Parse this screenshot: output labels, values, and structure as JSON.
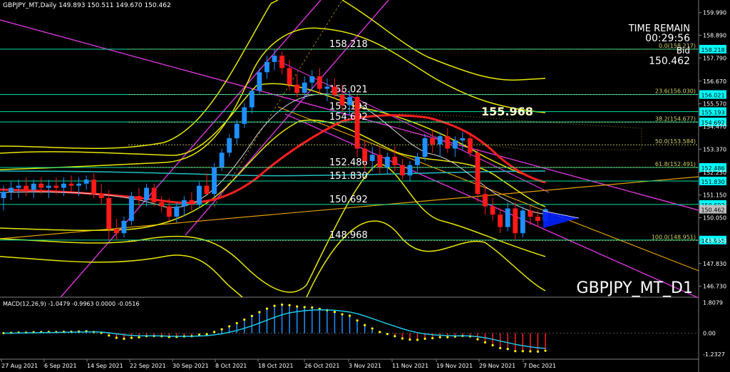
{
  "header": {
    "symbol_line": "GBPJPY_MT,Daily  149.893 150.511 149.670 150.462",
    "time_remain_label": "TIME REMAIN",
    "time_remain_value": "00:29:56",
    "bid_label": "Bid",
    "bid_value": "150.462",
    "big_price": "155.968",
    "watermark": "GBPJPY_MT_D1"
  },
  "colors": {
    "background": "#000000",
    "bull_candle": "#1e90ff",
    "bear_candle": "#ff1a1a",
    "level_line": "#00e0a0",
    "channel_line": "#cc33cc",
    "bollinger": "#ffff33",
    "ma_red": "#ff2020",
    "ma_cyan": "#20c0c0",
    "trend_orange": "#e0a000",
    "price_tag": "#00ffff",
    "macd_signal": "#ffff00",
    "macd_line": "#20c8e8"
  },
  "chart_data": {
    "type": "candlestick",
    "ylim": [
      146.2,
      160.6
    ],
    "price_axis_ticks": [
      "159.990",
      "158.890",
      "157.790",
      "156.670",
      "155.570",
      "154.470",
      "153.370",
      "152.250",
      "151.150",
      "150.050",
      "148.950",
      "147.830",
      "146.730"
    ],
    "date_labels": [
      "27 Aug 2021",
      "6 Sep 2021",
      "14 Sep 2021",
      "22 Sep 2021",
      "30 Sep 2021",
      "8 Oct 2021",
      "18 Oct 2021",
      "26 Oct 2021",
      "3 Nov 2021",
      "11 Nov 2021",
      "19 Nov 2021",
      "29 Nov 2021",
      "7 Dec 2021"
    ],
    "candles": [
      {
        "o": 151.0,
        "h": 151.6,
        "l": 150.4,
        "c": 151.3
      },
      {
        "o": 151.3,
        "h": 151.8,
        "l": 150.9,
        "c": 151.5
      },
      {
        "o": 151.5,
        "h": 151.9,
        "l": 151.0,
        "c": 151.6
      },
      {
        "o": 151.6,
        "h": 152.0,
        "l": 151.1,
        "c": 151.4
      },
      {
        "o": 151.4,
        "h": 151.9,
        "l": 151.0,
        "c": 151.7
      },
      {
        "o": 151.7,
        "h": 152.0,
        "l": 151.2,
        "c": 151.5
      },
      {
        "o": 151.5,
        "h": 151.9,
        "l": 151.0,
        "c": 151.6
      },
      {
        "o": 151.6,
        "h": 152.0,
        "l": 151.2,
        "c": 151.5
      },
      {
        "o": 151.5,
        "h": 152.0,
        "l": 151.1,
        "c": 151.7
      },
      {
        "o": 151.7,
        "h": 152.1,
        "l": 151.3,
        "c": 151.6
      },
      {
        "o": 151.6,
        "h": 152.0,
        "l": 151.1,
        "c": 151.7
      },
      {
        "o": 151.7,
        "h": 152.1,
        "l": 151.4,
        "c": 151.9
      },
      {
        "o": 151.9,
        "h": 152.2,
        "l": 151.0,
        "c": 151.2
      },
      {
        "o": 151.2,
        "h": 151.7,
        "l": 150.7,
        "c": 151.0
      },
      {
        "o": 151.0,
        "h": 151.4,
        "l": 149.0,
        "c": 149.5
      },
      {
        "o": 149.5,
        "h": 150.0,
        "l": 149.0,
        "c": 149.3
      },
      {
        "o": 149.3,
        "h": 150.1,
        "l": 149.1,
        "c": 149.9
      },
      {
        "o": 149.9,
        "h": 151.3,
        "l": 149.7,
        "c": 151.1
      },
      {
        "o": 151.1,
        "h": 151.5,
        "l": 150.6,
        "c": 150.9
      },
      {
        "o": 150.9,
        "h": 151.7,
        "l": 150.6,
        "c": 151.5
      },
      {
        "o": 151.5,
        "h": 151.7,
        "l": 150.6,
        "c": 150.8
      },
      {
        "o": 150.8,
        "h": 151.1,
        "l": 150.3,
        "c": 150.6
      },
      {
        "o": 150.6,
        "h": 151.0,
        "l": 149.9,
        "c": 150.1
      },
      {
        "o": 150.1,
        "h": 150.8,
        "l": 149.8,
        "c": 150.6
      },
      {
        "o": 150.6,
        "h": 151.1,
        "l": 150.1,
        "c": 150.9
      },
      {
        "o": 150.9,
        "h": 151.3,
        "l": 150.4,
        "c": 150.7
      },
      {
        "o": 150.7,
        "h": 151.8,
        "l": 150.5,
        "c": 151.6
      },
      {
        "o": 151.6,
        "h": 152.2,
        "l": 151.3,
        "c": 151.2
      },
      {
        "o": 151.2,
        "h": 152.7,
        "l": 151.0,
        "c": 152.5
      },
      {
        "o": 152.5,
        "h": 153.4,
        "l": 152.3,
        "c": 153.2
      },
      {
        "o": 153.2,
        "h": 154.1,
        "l": 153.0,
        "c": 153.9
      },
      {
        "o": 153.9,
        "h": 154.8,
        "l": 153.6,
        "c": 154.6
      },
      {
        "o": 154.6,
        "h": 155.6,
        "l": 154.4,
        "c": 155.4
      },
      {
        "o": 155.4,
        "h": 156.3,
        "l": 155.1,
        "c": 156.2
      },
      {
        "o": 156.2,
        "h": 157.3,
        "l": 156.0,
        "c": 157.1
      },
      {
        "o": 157.1,
        "h": 157.9,
        "l": 156.8,
        "c": 157.6
      },
      {
        "o": 157.6,
        "h": 158.2,
        "l": 157.2,
        "c": 157.9
      },
      {
        "o": 157.9,
        "h": 158.1,
        "l": 157.0,
        "c": 157.3
      },
      {
        "o": 157.3,
        "h": 157.7,
        "l": 156.2,
        "c": 156.5
      },
      {
        "o": 156.5,
        "h": 157.0,
        "l": 155.9,
        "c": 156.1
      },
      {
        "o": 156.1,
        "h": 156.9,
        "l": 155.8,
        "c": 156.6
      },
      {
        "o": 156.6,
        "h": 157.2,
        "l": 156.2,
        "c": 156.9
      },
      {
        "o": 156.9,
        "h": 157.3,
        "l": 156.0,
        "c": 156.3
      },
      {
        "o": 156.3,
        "h": 156.8,
        "l": 155.7,
        "c": 156.4
      },
      {
        "o": 156.4,
        "h": 156.8,
        "l": 155.8,
        "c": 156.0
      },
      {
        "o": 156.0,
        "h": 156.5,
        "l": 155.2,
        "c": 155.5
      },
      {
        "o": 155.5,
        "h": 156.2,
        "l": 155.0,
        "c": 155.9
      },
      {
        "o": 155.9,
        "h": 156.0,
        "l": 153.0,
        "c": 153.4
      },
      {
        "o": 153.4,
        "h": 153.8,
        "l": 152.3,
        "c": 152.8
      },
      {
        "o": 152.8,
        "h": 153.5,
        "l": 152.3,
        "c": 153.1
      },
      {
        "o": 153.1,
        "h": 153.5,
        "l": 152.2,
        "c": 152.5
      },
      {
        "o": 152.5,
        "h": 153.2,
        "l": 152.2,
        "c": 153.0
      },
      {
        "o": 153.0,
        "h": 153.5,
        "l": 152.3,
        "c": 152.6
      },
      {
        "o": 152.6,
        "h": 152.9,
        "l": 151.9,
        "c": 152.1
      },
      {
        "o": 152.1,
        "h": 152.8,
        "l": 151.8,
        "c": 152.6
      },
      {
        "o": 152.6,
        "h": 153.2,
        "l": 152.3,
        "c": 153.0
      },
      {
        "o": 153.0,
        "h": 154.1,
        "l": 152.8,
        "c": 153.9
      },
      {
        "o": 153.9,
        "h": 154.3,
        "l": 153.2,
        "c": 153.6
      },
      {
        "o": 153.6,
        "h": 154.2,
        "l": 153.0,
        "c": 154.0
      },
      {
        "o": 154.0,
        "h": 154.4,
        "l": 153.2,
        "c": 153.4
      },
      {
        "o": 153.4,
        "h": 154.0,
        "l": 153.0,
        "c": 153.8
      },
      {
        "o": 153.8,
        "h": 154.2,
        "l": 153.3,
        "c": 153.9
      },
      {
        "o": 153.9,
        "h": 154.2,
        "l": 153.0,
        "c": 153.2
      },
      {
        "o": 153.2,
        "h": 153.4,
        "l": 150.8,
        "c": 151.2
      },
      {
        "o": 151.2,
        "h": 151.6,
        "l": 150.2,
        "c": 150.6
      },
      {
        "o": 150.6,
        "h": 151.0,
        "l": 149.9,
        "c": 150.2
      },
      {
        "o": 150.2,
        "h": 150.5,
        "l": 149.3,
        "c": 149.6
      },
      {
        "o": 149.6,
        "h": 150.8,
        "l": 149.4,
        "c": 150.5
      },
      {
        "o": 150.5,
        "h": 150.8,
        "l": 149.0,
        "c": 149.3
      },
      {
        "o": 149.3,
        "h": 150.6,
        "l": 149.1,
        "c": 150.4
      },
      {
        "o": 150.4,
        "h": 150.7,
        "l": 149.7,
        "c": 150.1
      },
      {
        "o": 150.1,
        "h": 150.4,
        "l": 149.6,
        "c": 149.9
      },
      {
        "o": 149.893,
        "h": 150.511,
        "l": 149.67,
        "c": 150.462
      }
    ],
    "horizontal_levels": [
      {
        "price": 158.218,
        "label": "158.218"
      },
      {
        "price": 156.021,
        "label": "156.021"
      },
      {
        "price": 155.193,
        "label": "155.193"
      },
      {
        "price": 154.692,
        "label": "154.692"
      },
      {
        "price": 152.486,
        "label": "152.486"
      },
      {
        "price": 151.83,
        "label": "151.830"
      },
      {
        "price": 150.692,
        "label": "150.692"
      },
      {
        "price": 148.968,
        "label": "148.968"
      }
    ],
    "fib_levels": [
      {
        "price": 158.217,
        "label": "0.0(158.217)"
      },
      {
        "price": 156.03,
        "label": "23.6(156.030)"
      },
      {
        "price": 154.677,
        "label": "38.2(154.677)"
      },
      {
        "price": 153.584,
        "label": "50.0(153.584)"
      },
      {
        "price": 152.491,
        "label": "61.8(152.491)"
      },
      {
        "price": 148.951,
        "label": "100.0(148.951)"
      }
    ],
    "macd": {
      "label": "MACD(12,26,9) -1.0479 -0.9963 0.0000 -0.0516",
      "ylim": [
        -1.45,
        2.0
      ],
      "ticks": [
        "1.8079",
        "0.00",
        "-1.2327"
      ]
    }
  }
}
